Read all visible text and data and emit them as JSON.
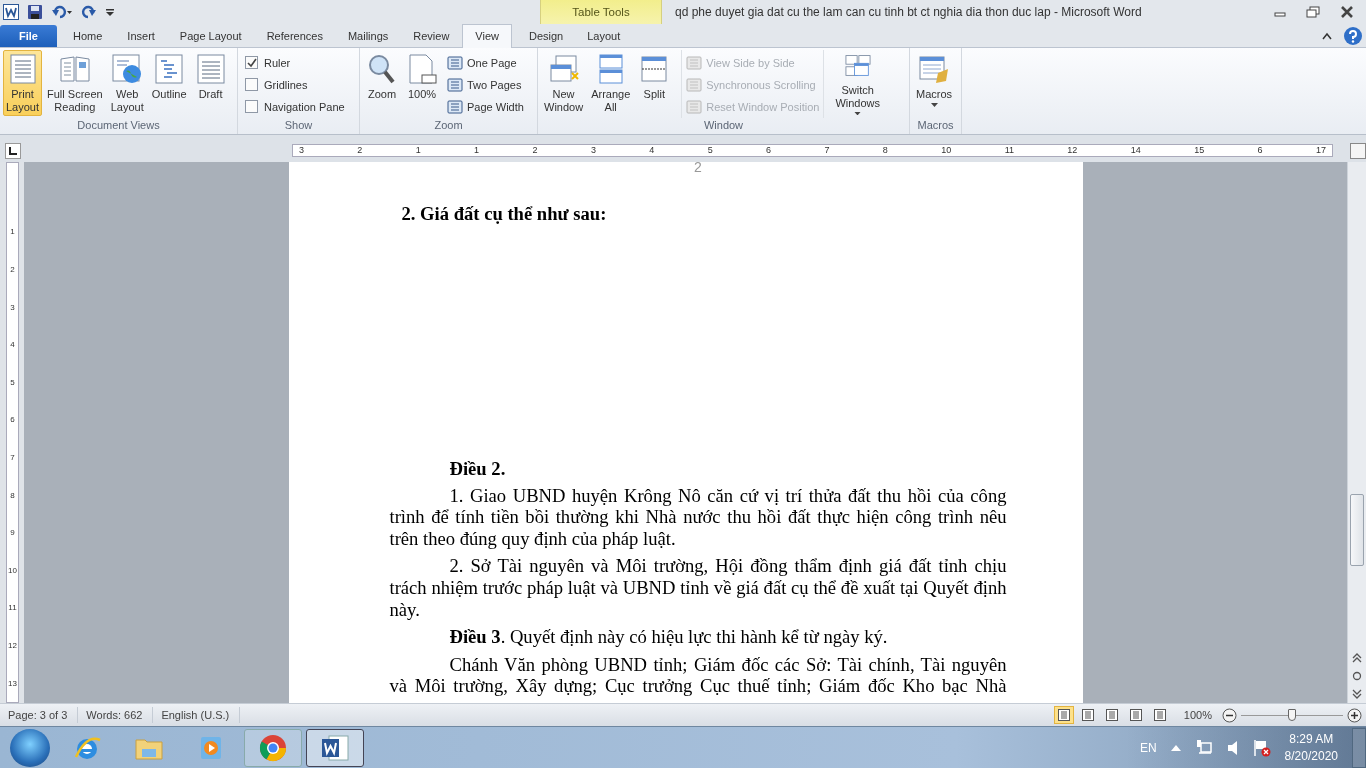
{
  "title_bar": {
    "contextual_label": "Table Tools",
    "title": "qd phe duyet gia dat cu the lam can cu tinh bt ct nghia dia thon duc lap  -  Microsoft Word"
  },
  "tabs": [
    {
      "label": "File",
      "kind": "file",
      "selected": false
    },
    {
      "label": "Home",
      "kind": "normal",
      "selected": false
    },
    {
      "label": "Insert",
      "kind": "normal",
      "selected": false
    },
    {
      "label": "Page Layout",
      "kind": "normal",
      "selected": false
    },
    {
      "label": "References",
      "kind": "normal",
      "selected": false
    },
    {
      "label": "Mailings",
      "kind": "normal",
      "selected": false
    },
    {
      "label": "Review",
      "kind": "normal",
      "selected": false
    },
    {
      "label": "View",
      "kind": "normal",
      "selected": true
    },
    {
      "label": "Design",
      "kind": "contextual",
      "selected": false
    },
    {
      "label": "Layout",
      "kind": "contextual",
      "selected": false
    }
  ],
  "ribbon_groups": [
    {
      "label": "Document Views",
      "items": [
        {
          "kind": "large",
          "label": "Print\nLayout",
          "selected": true,
          "dropdown": false
        },
        {
          "kind": "large",
          "label": "Full Screen\nReading",
          "selected": false,
          "dropdown": false
        },
        {
          "kind": "large",
          "label": "Web\nLayout",
          "selected": false,
          "dropdown": false
        },
        {
          "kind": "large",
          "label": "Outline",
          "selected": false,
          "dropdown": false
        },
        {
          "kind": "large",
          "label": "Draft",
          "selected": false,
          "dropdown": false
        }
      ]
    },
    {
      "label": "Show",
      "items": [
        {
          "kind": "check",
          "label": "Ruler",
          "checked": true
        },
        {
          "kind": "check",
          "label": "Gridlines",
          "checked": false
        },
        {
          "kind": "check",
          "label": "Navigation Pane",
          "checked": false
        }
      ]
    },
    {
      "label": "Zoom",
      "items": [
        {
          "kind": "large",
          "label": "Zoom",
          "selected": false,
          "dropdown": false
        },
        {
          "kind": "large",
          "label": "100%",
          "selected": false,
          "dropdown": false
        },
        {
          "kind": "small",
          "label": "One Page",
          "disabled": false
        },
        {
          "kind": "small",
          "label": "Two Pages",
          "disabled": false
        },
        {
          "kind": "small",
          "label": "Page Width",
          "disabled": false
        }
      ]
    },
    {
      "label": "Window",
      "items": [
        {
          "kind": "large",
          "label": "New\nWindow",
          "selected": false,
          "dropdown": false
        },
        {
          "kind": "large",
          "label": "Arrange\nAll",
          "selected": false,
          "dropdown": false
        },
        {
          "kind": "large",
          "label": "Split",
          "selected": false,
          "dropdown": false
        },
        {
          "kind": "small",
          "label": "View Side by Side",
          "disabled": true
        },
        {
          "kind": "small",
          "label": "Synchronous Scrolling",
          "disabled": true
        },
        {
          "kind": "small",
          "label": "Reset Window Position",
          "disabled": true
        },
        {
          "kind": "large",
          "label": "Switch\nWindows",
          "selected": false,
          "dropdown": true
        }
      ]
    },
    {
      "label": "Macros",
      "items": [
        {
          "kind": "large",
          "label": "Macros",
          "selected": false,
          "dropdown": true
        }
      ]
    }
  ],
  "ruler": {
    "labels": [
      "3",
      "2",
      "1",
      "1",
      "2",
      "3",
      "4",
      "5",
      "6",
      "7",
      "8",
      "10",
      "11",
      "12",
      "14",
      "15",
      "6",
      "17"
    ]
  },
  "vertical_ruler": {
    "labels": [
      "1",
      "2",
      "3",
      "4",
      "5",
      "6",
      "7",
      "8",
      "9",
      "10",
      "11",
      "12",
      "13"
    ]
  },
  "document": {
    "page_number": "2",
    "heading": "2. Giá đất cụ thể như sau:",
    "paragraphs": [
      {
        "kind": "heading",
        "text": "Điều 2."
      },
      {
        "kind": "body",
        "text": "1. Giao UBND huyện Krông Nô căn cứ vị trí thửa đất thu hồi của công trình để tính tiền bồi thường khi Nhà nước thu hồi đất thực hiện công trình nêu trên theo đúng quy định của pháp luật."
      },
      {
        "kind": "body",
        "text": "2. Sở Tài nguyên và Môi trường, Hội đồng thẩm định giá đất tỉnh chịu trách nhiệm trước pháp luật và UBND tỉnh về giá đất cụ thể đề xuất tại Quyết định này."
      },
      {
        "kind": "body",
        "text": "**Điều 3**. Quyết định này có hiệu lực thi hành kể từ ngày ký."
      },
      {
        "kind": "body_cut",
        "text": "Chánh Văn phòng UBND tỉnh; Giám đốc các Sở: Tài chính, Tài nguyên và Môi trường, Xây dựng; Cục trưởng Cục thuế tỉnh; Giám đốc Kho bạc Nhà"
      }
    ]
  },
  "status_bar": {
    "items": [
      "Page: 3 of 3",
      "Words: 662",
      "English (U.S.)"
    ],
    "view_buttons": [
      {
        "selected": true
      },
      {
        "selected": false
      },
      {
        "selected": false
      },
      {
        "selected": false
      },
      {
        "selected": false
      }
    ],
    "zoom_label": "100%",
    "zoom": {
      "level": 0.5
    }
  },
  "taskbar": {
    "apps": [
      {
        "selected": false,
        "running": false
      },
      {
        "selected": false,
        "running": false
      },
      {
        "selected": false,
        "running": false
      },
      {
        "selected": false,
        "running": true
      },
      {
        "selected": true,
        "running": true
      }
    ],
    "language": "EN",
    "time": "8:29 AM",
    "date": "8/20/2020"
  }
}
